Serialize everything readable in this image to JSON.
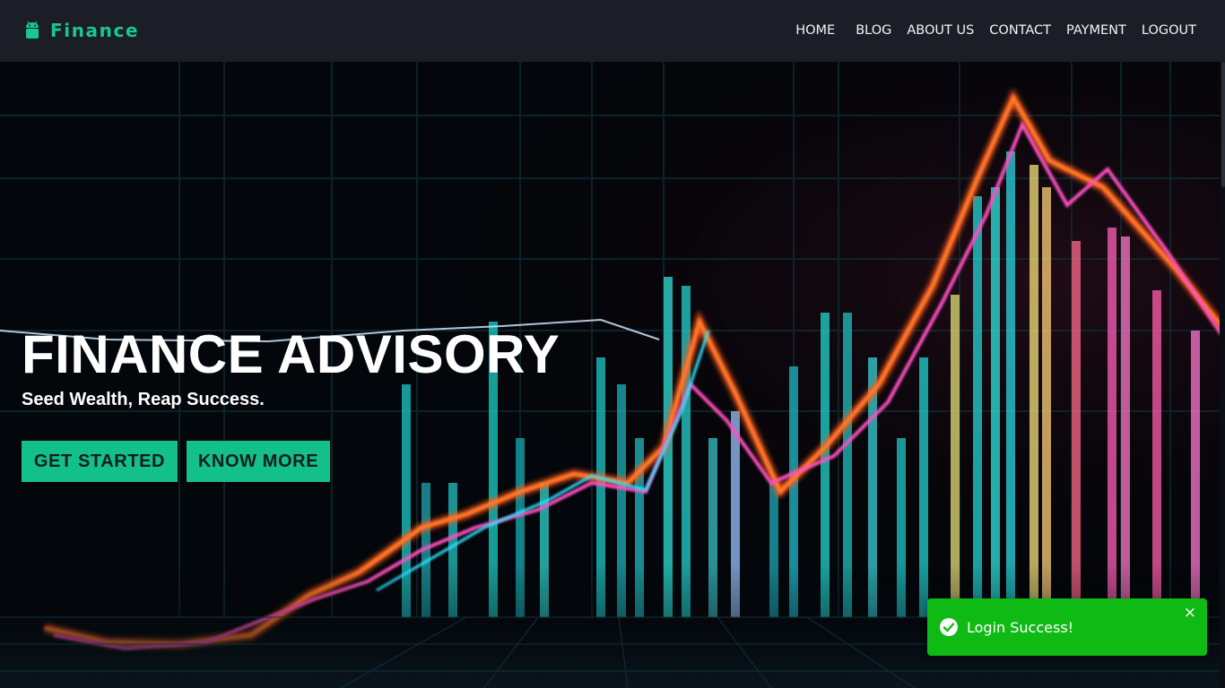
{
  "brand": {
    "name": "Finance",
    "icon": "android-icon",
    "color": "#19c68e"
  },
  "nav": {
    "items": [
      {
        "label": "HOME"
      },
      {
        "label": "BLOG"
      },
      {
        "label": "ABOUT US"
      },
      {
        "label": "CONTACT"
      },
      {
        "label": "PAYMENT"
      },
      {
        "label": "LOGOUT"
      }
    ]
  },
  "hero": {
    "title": "FINANCE ADVISORY",
    "subtitle": "Seed Wealth, Reap Success.",
    "primary_button": "GET STARTED",
    "secondary_button": "KNOW MORE",
    "accent": "#14c08a",
    "background": "neon-finance-chart-image"
  },
  "toast": {
    "message": "Login Success!",
    "icon": "check-circle-icon",
    "close": "×",
    "color": "#0fba14"
  }
}
